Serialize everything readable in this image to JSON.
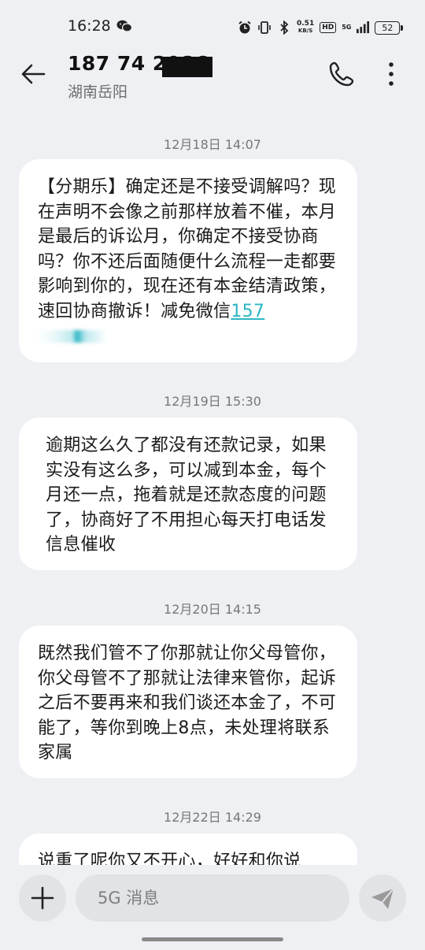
{
  "status_bar": {
    "time": "16:28",
    "net_speed_value": "0.51",
    "net_speed_unit": "KB/S",
    "hd": "HD",
    "network": "5G",
    "battery": "52"
  },
  "header": {
    "contact": "187 74  2086",
    "location": "湖南岳阳"
  },
  "messages": [
    {
      "timestamp": "12月18日 14:07",
      "text": "【分期乐】确定还是不接受调解吗？现在声明不会像之前那样放着不催，本月是最后的诉讼月，你确定不接受协商吗？你不还后面随便什么流程一走都要影响到你的，现在还有本金结清政策，速回协商撤诉！减免微信",
      "link": "157"
    },
    {
      "timestamp": "12月19日 15:30",
      "text": "逾期这么久了都没有还款记录，如果实没有这么多，可以减到本金，每个月还一点，拖着就是还款态度的问题了，协商好了不用担心每天打电话发信息催收"
    },
    {
      "timestamp": "12月20日 14:15",
      "text": "既然我们管不了你那就让你父母管你，你父母管不了那就让法律来管你，起诉之后不要再来和我们谈还本金了，不可能了，等你到晚上8点，未处理将联系家属"
    },
    {
      "timestamp": "12月22日 14:29",
      "text": "说重了呢你又不开心，好好和你说"
    }
  ],
  "composer": {
    "placeholder": "5G 消息"
  }
}
